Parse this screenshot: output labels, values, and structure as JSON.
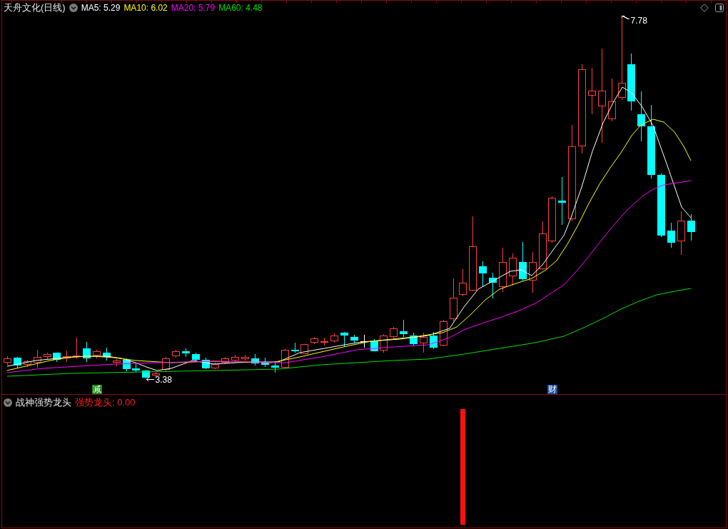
{
  "chart_header": {
    "title": "天舟文化(日线)",
    "moving_averages": [
      {
        "text": "MA5: 5.29",
        "color": "#ffffff"
      },
      {
        "text": "MA10: 6.02",
        "color": "#ffff00"
      },
      {
        "text": "MA20: 5.79",
        "color": "#ff00ff"
      },
      {
        "text": "MA60: 4.48",
        "color": "#00e000"
      }
    ]
  },
  "price_chart": {
    "high_label": "7.78",
    "low_label": "3.38",
    "signals": [
      {
        "text": "减",
        "color": "#108a10"
      },
      {
        "text": "财",
        "color": "#1f4e9a"
      }
    ]
  },
  "indicator_panel": {
    "title": "战神强势龙头",
    "reading": "强势龙头: 0.00"
  }
}
